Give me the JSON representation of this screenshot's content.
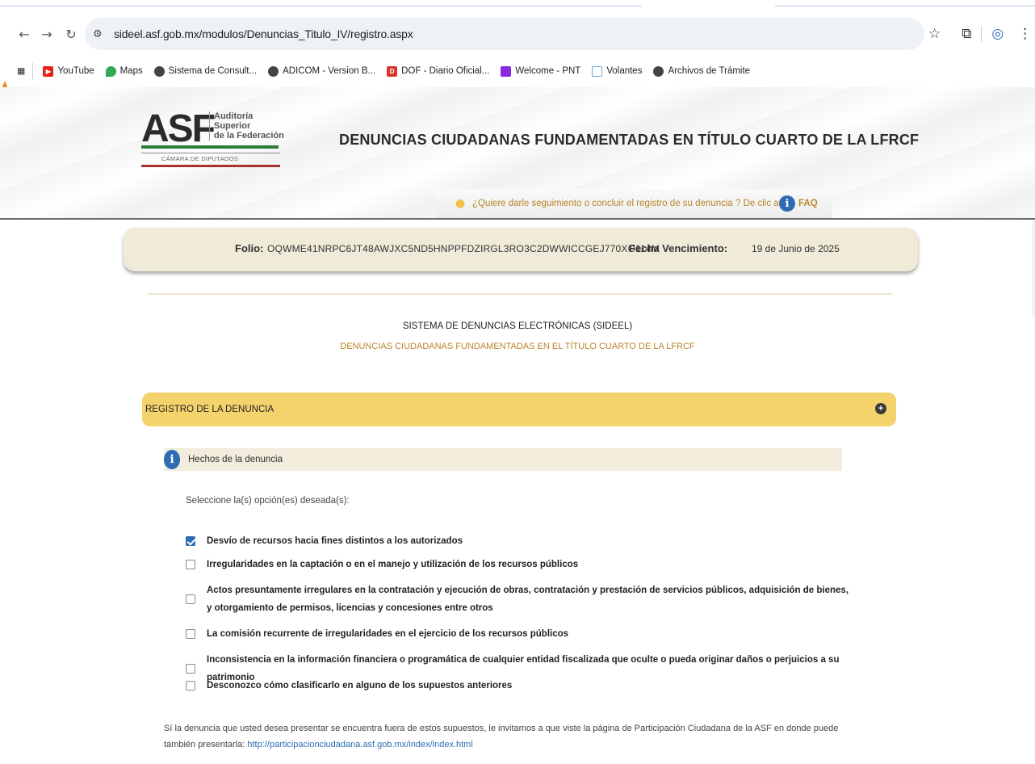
{
  "browser": {
    "url": "sideel.asf.gob.mx/modulos/Denuncias_Titulo_IV/registro.aspx",
    "bookmarks": [
      {
        "label": "YouTube",
        "icon": "youtube-icon",
        "color": "#e62117"
      },
      {
        "label": "Maps",
        "icon": "maps-icon",
        "color": "#34a853"
      },
      {
        "label": "Sistema de Consult...",
        "icon": "globe-icon",
        "color": "#444444"
      },
      {
        "label": "ADICOM - Version B...",
        "icon": "globe-icon",
        "color": "#444444"
      },
      {
        "label": "DOF - Diario Oficial...",
        "icon": "dof-icon",
        "color": "#d9362b"
      },
      {
        "label": "Welcome - PNT",
        "icon": "pnt-icon",
        "color": "#8a2be2"
      },
      {
        "label": "Volantes",
        "icon": "document-icon",
        "color": "#6fa8dc"
      },
      {
        "label": "Archivos de Trámite",
        "icon": "globe-icon",
        "color": "#444444"
      }
    ]
  },
  "header": {
    "logo_main": "ASF",
    "logo_line1": "Auditoría",
    "logo_line2": "Superior",
    "logo_line3": "de la Federación",
    "logo_sub": "CÁMARA DE DIPUTADOS",
    "title": "DENUNCIAS CIUDADANAS FUNDAMENTADAS EN TÍTULO CUARTO DE LA LFRCF",
    "help_text": "¿Quiere darle seguimiento o concluir el registro de su denuncia ? De clic aquí.",
    "faq_label": "FAQ"
  },
  "folio": {
    "label": "Folio:",
    "value": "OQWME41NRPC6JT48AWJXC5ND5HNPPFDZIRGL3RO3C2DWWICCGEJ770XO114M",
    "venc_label": "Fecha Vencimiento:",
    "venc_value": "19 de Junio de 2025"
  },
  "system": {
    "title": "SISTEMA DE DENUNCIAS ELECTRÓNICAS (SIDEEL)",
    "subtitle": "DENUNCIAS CIUDADANAS FUNDAMENTADAS EN EL TÍTULO CUARTO DE LA LFRCF"
  },
  "registro": {
    "title": "REGISTRO DE LA DENUNCIA",
    "section_label": "Hechos de la denuncia",
    "prompt": "Seleccione la(s) opción(es) deseada(s):",
    "options": [
      {
        "label": "Desvío de recursos hacia fines distintos a los autorizados",
        "checked": true
      },
      {
        "label": "Irregularidades en la captación o en el manejo y utilización de los recursos públicos",
        "checked": false
      },
      {
        "label": "Actos presuntamente irregulares en la contratación y ejecución de obras, contratación y prestación de servicios públicos, adquisición de bienes, y otorgamiento de permisos, licencias y concesiones entre otros",
        "checked": false
      },
      {
        "label": "La comisión recurrente de irregularidades en el ejercicio de los recursos públicos",
        "checked": false
      },
      {
        "label": "Inconsistencia en la información financiera o programática de cualquier entidad fiscalizada que oculte o pueda originar daños o perjuicios a su patrimonio",
        "checked": false
      },
      {
        "label": "Desconozco cómo clasificarlo en alguno de los supuestos anteriores",
        "checked": false
      }
    ],
    "footer_text": "Sí la denuncia que usted desea presentar se encuentra fuera de estos supuestos, le invitamos a que viste la página de Participación Ciudadana de la ASF en donde puede también presentarla: ",
    "footer_link": "http://participacionciudadana.asf.gob.mx/index/index.html"
  }
}
